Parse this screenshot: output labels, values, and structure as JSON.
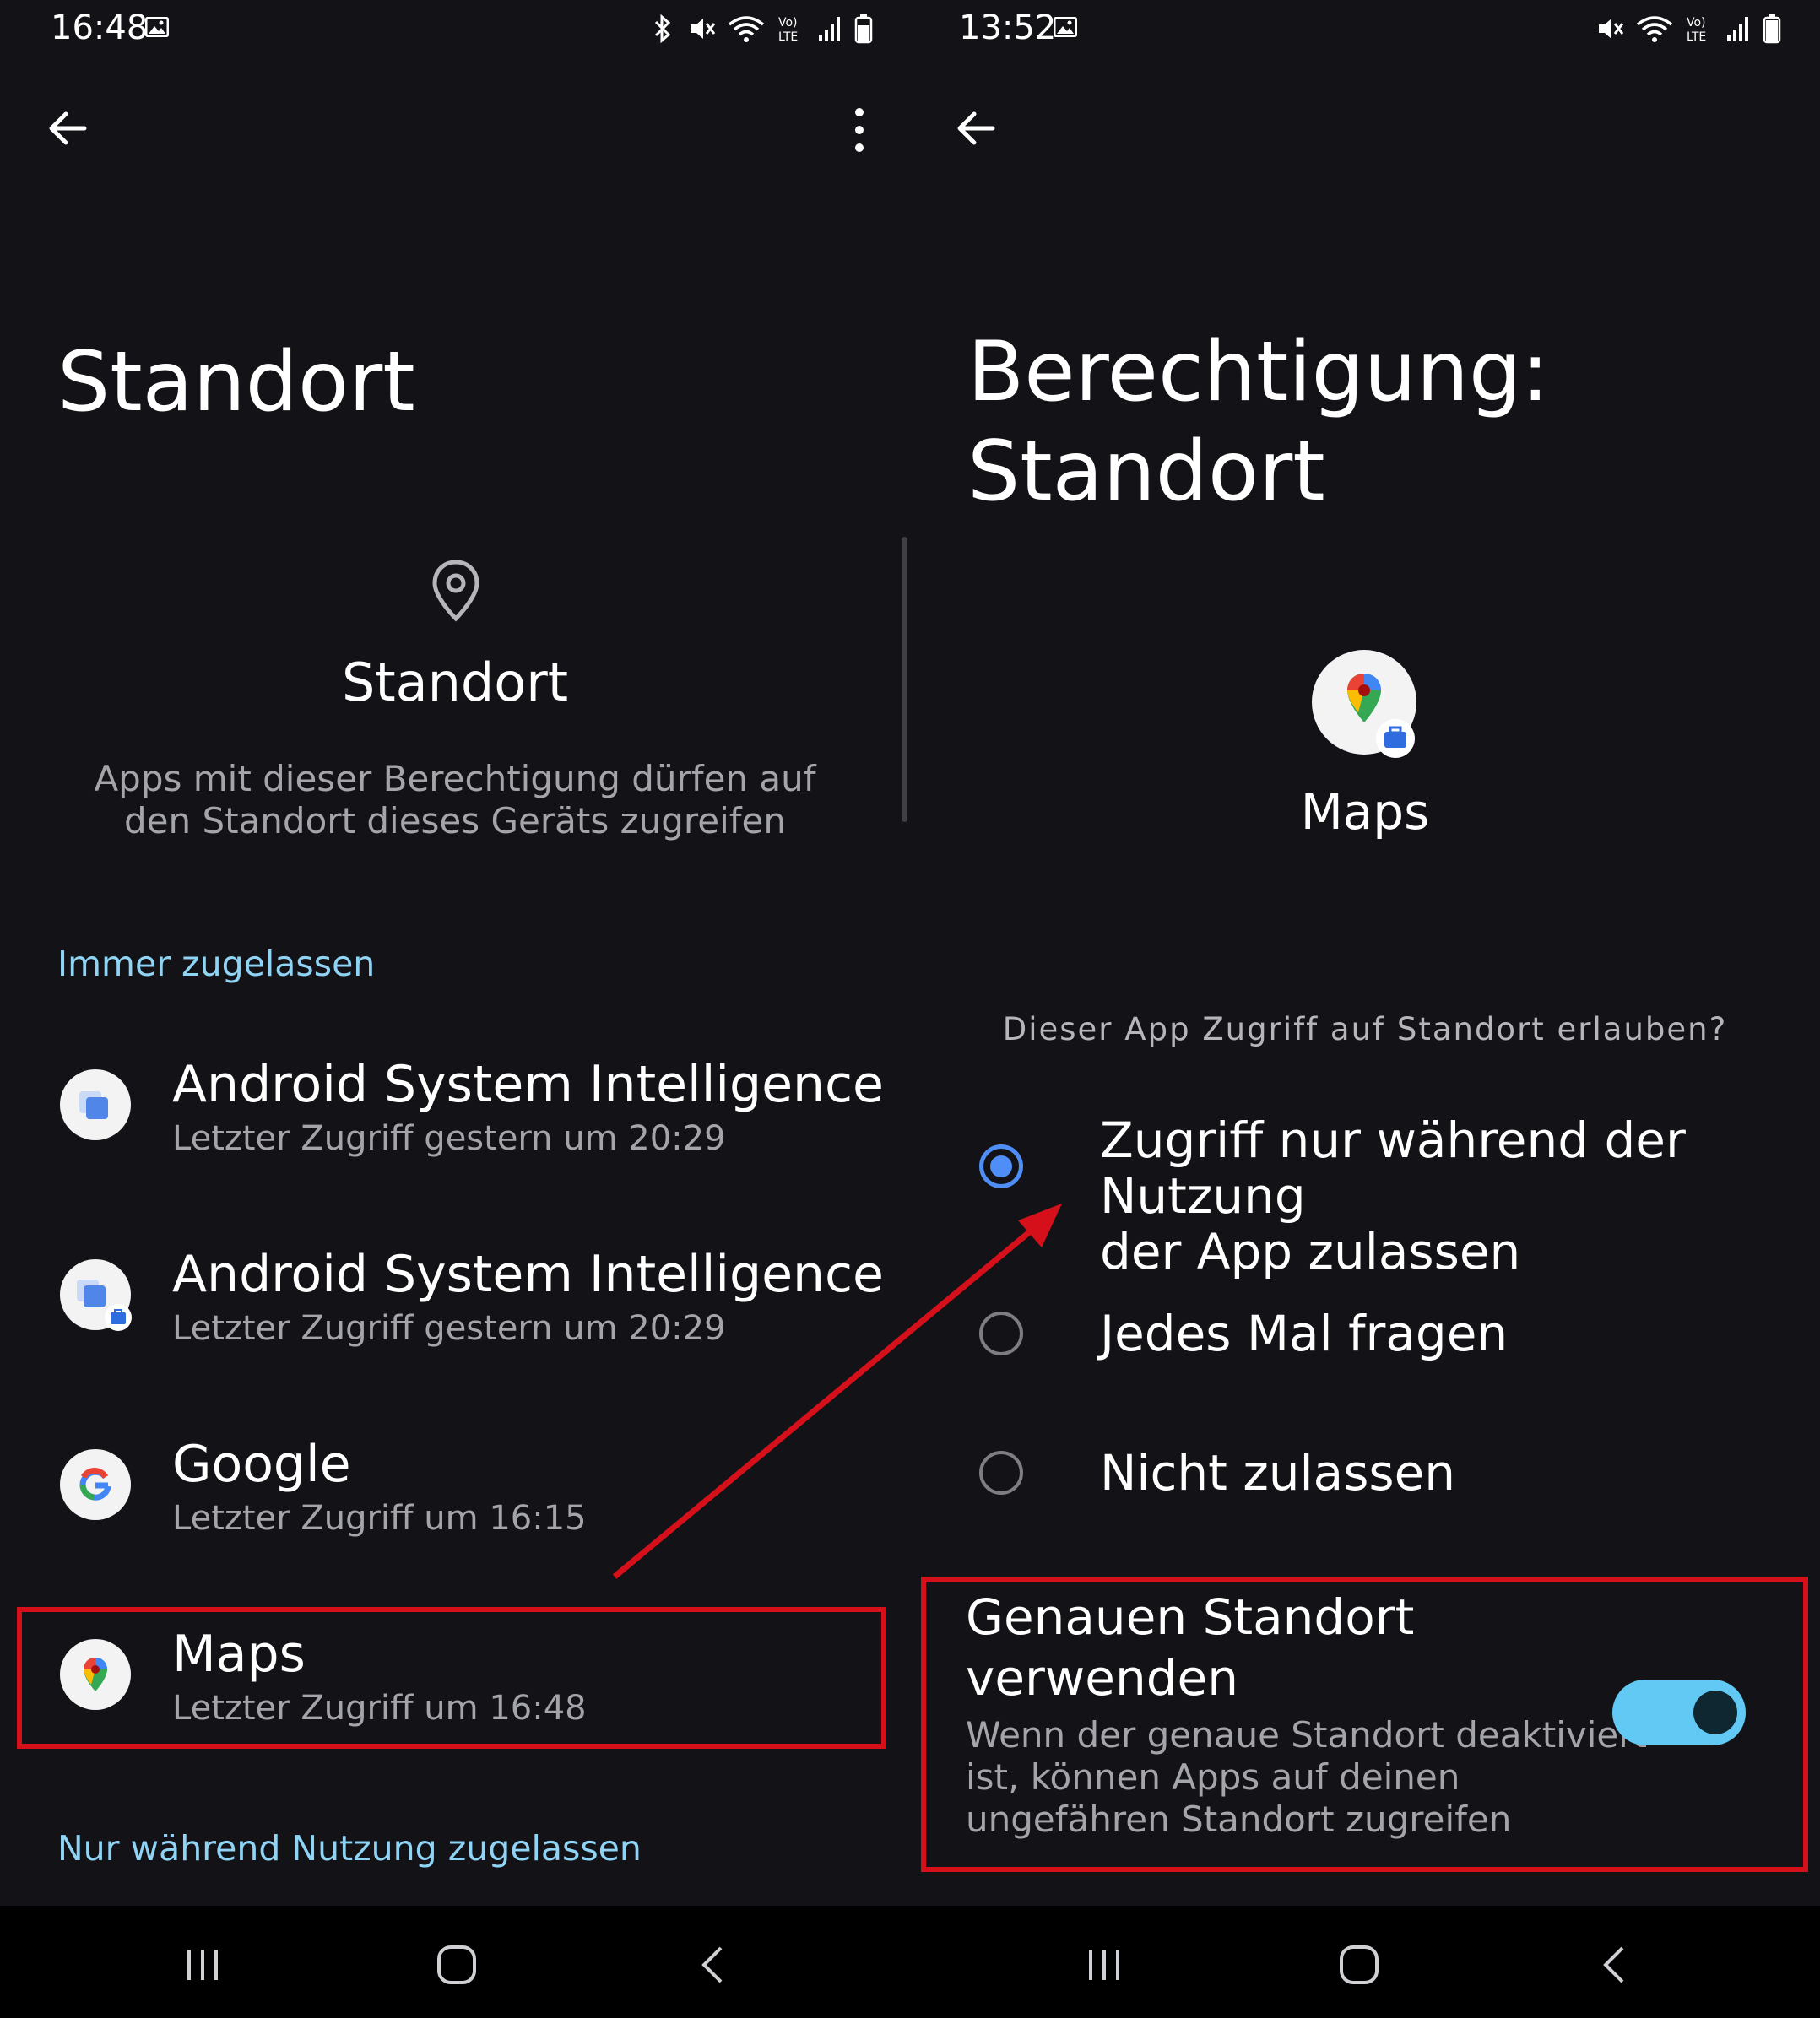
{
  "left": {
    "status": {
      "time": "16:48"
    },
    "title": "Standort",
    "header": {
      "icon": "location-pin-icon",
      "title": "Standort",
      "description_line1": "Apps mit dieser Berechtigung dürfen auf",
      "description_line2": "den Standort dieses Geräts zugreifen"
    },
    "section_always": "Immer zugelassen",
    "apps": [
      {
        "name": "Android System Intelligence",
        "sub": "Letzter Zugriff gestern um 20:29",
        "icon": "android-system-intelligence-icon"
      },
      {
        "name": "Android System Intelligence",
        "sub": "Letzter Zugriff gestern um 20:29",
        "icon": "android-system-intelligence-work-icon"
      },
      {
        "name": "Google",
        "sub": "Letzter Zugriff um 16:15",
        "icon": "google-icon"
      },
      {
        "name": "Maps",
        "sub": "Letzter Zugriff um 16:48",
        "icon": "maps-icon"
      }
    ],
    "section_while_using": "Nur während Nutzung zugelassen"
  },
  "right": {
    "status": {
      "time": "13:52"
    },
    "title_line1": "Berechtigung:",
    "title_line2": "Standort",
    "app_name": "Maps",
    "question": "Dieser App Zugriff auf Standort erlauben?",
    "options": [
      {
        "line1": "Zugriff nur während der Nutzung",
        "line2": "der App zulassen",
        "selected": true
      },
      {
        "line1": "Jedes Mal fragen",
        "selected": false
      },
      {
        "line1": "Nicht zulassen",
        "selected": false
      }
    ],
    "precise": {
      "title_line1": "Genauen Standort",
      "title_line2": "verwenden",
      "desc_line1": "Wenn der genaue Standort deaktiviert",
      "desc_line2": "ist, können Apps auf deinen",
      "desc_line3": "ungefähren Standort zugreifen",
      "enabled": true
    }
  },
  "colors": {
    "background": "#131317",
    "accent_section": "#8fd4f5",
    "radio_selected": "#4f8ef7",
    "toggle_on": "#62c9f5",
    "annotation_red": "#d6101a"
  }
}
